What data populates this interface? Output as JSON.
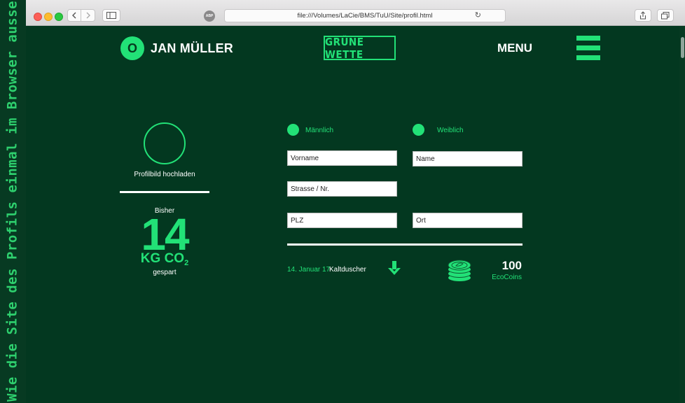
{
  "side_caption": "Wie die Site des Profils einmal im Browser aussehen könnte",
  "browser": {
    "url": "file:///Volumes/LaCie/BMS/TuU/Site/profil.html",
    "abp_label": "ABP"
  },
  "header": {
    "logo_letter": "O",
    "user_name": "JAN MÜLLER",
    "brand": "GRÜNE WETTE",
    "menu_label": "MENU"
  },
  "profile": {
    "upload_label": "Profilbild hochladen",
    "stat_prefix": "Bisher",
    "stat_value": "14",
    "stat_unit": "KG CO",
    "stat_unit_sub": "2",
    "stat_suffix": "gespart"
  },
  "form": {
    "gender_male": "Männlich",
    "gender_female": "Weiblich",
    "firstname_placeholder": "Vorname",
    "lastname_placeholder": "Name",
    "street_placeholder": "Strasse / Nr.",
    "zip_placeholder": "PLZ",
    "city_placeholder": "Ort"
  },
  "activity": {
    "date": "14. Januar 17",
    "name": "Kaltduscher",
    "coins_value": "100",
    "coins_label": "EcoCoins"
  },
  "colors": {
    "background": "#033820",
    "accent": "#22e177",
    "text": "#ffffff"
  }
}
